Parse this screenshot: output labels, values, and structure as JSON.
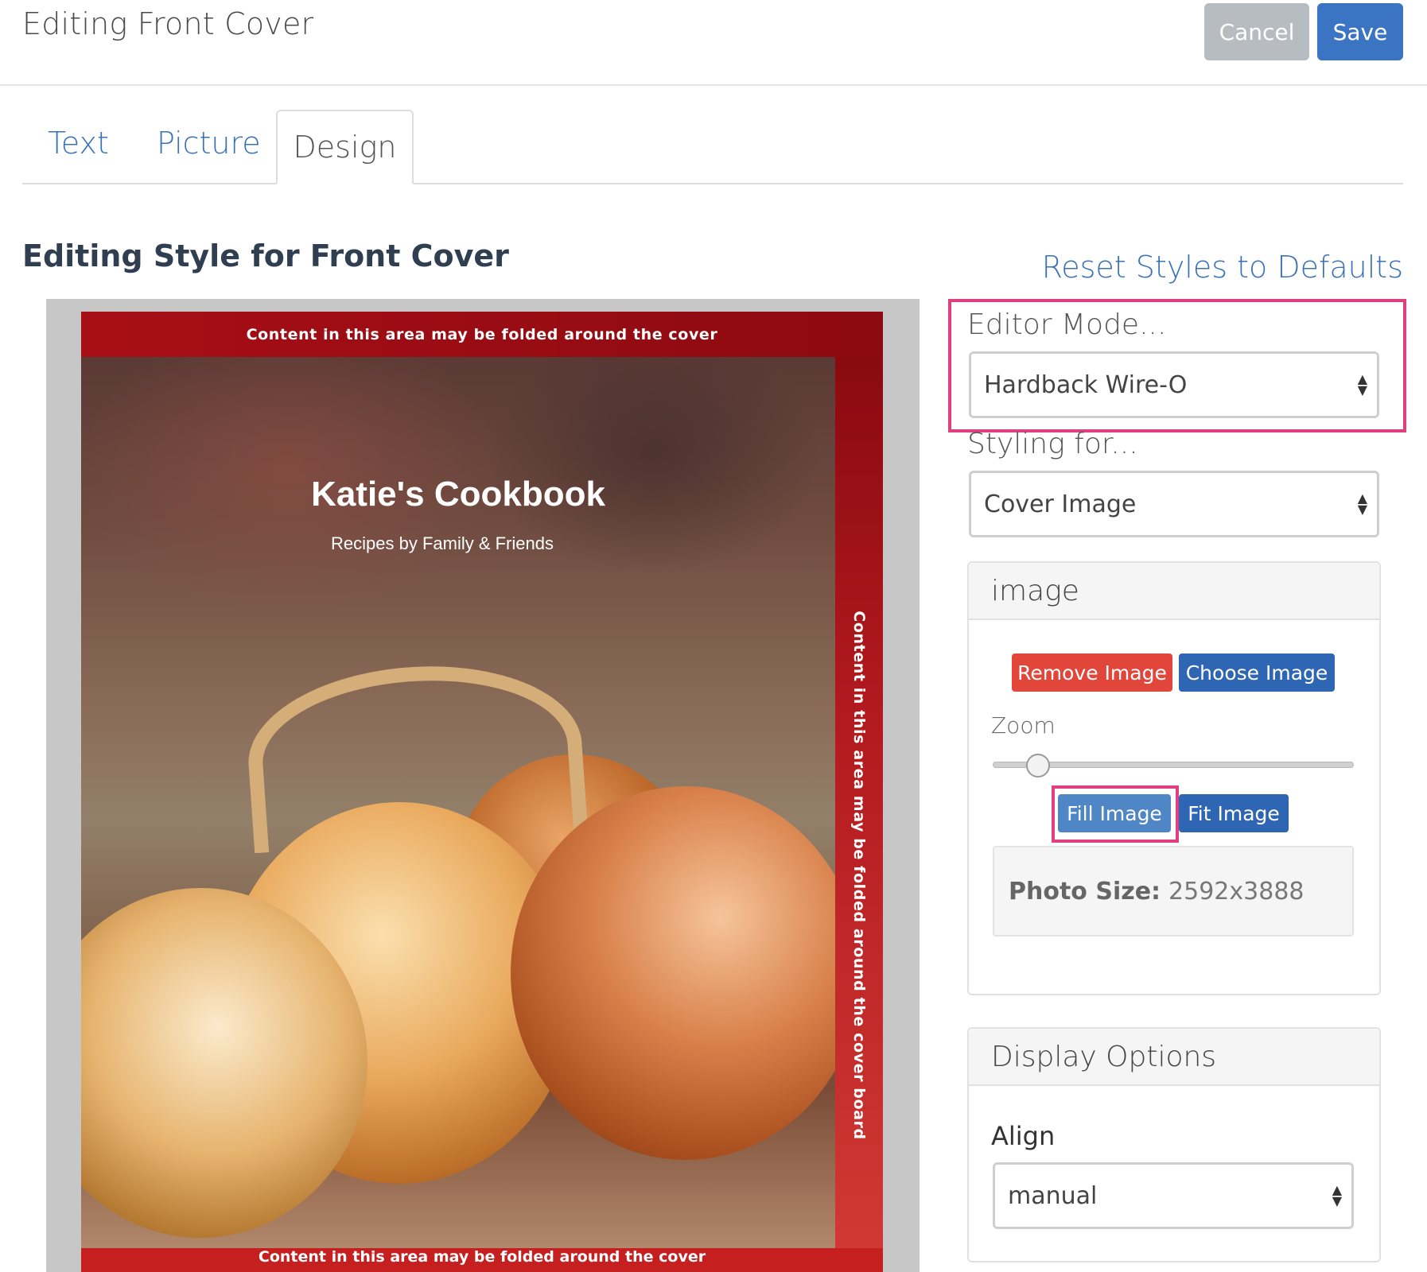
{
  "header": {
    "title": "Editing Front Cover",
    "cancel_label": "Cancel",
    "save_label": "Save"
  },
  "tabs": [
    {
      "label": "Text",
      "active": false
    },
    {
      "label": "Picture",
      "active": false
    },
    {
      "label": "Design",
      "active": true
    }
  ],
  "section": {
    "title": "Editing Style for Front Cover",
    "reset_label": "Reset Styles to Defaults"
  },
  "cover": {
    "fold_top_text": "Content in this area may be folded around the cover",
    "fold_right_text": "Content in this area may be folded around the cover board",
    "fold_bottom_text": "Content in this area may be folded around the cover",
    "title": "Katie's Cookbook",
    "subtitle": "Recipes by Family & Friends"
  },
  "editor_mode": {
    "label": "Editor Mode...",
    "value": "Hardback Wire-O"
  },
  "styling_for": {
    "label": "Styling for...",
    "value": "Cover Image"
  },
  "image_panel": {
    "heading": "image",
    "remove_label": "Remove Image",
    "choose_label": "Choose Image",
    "zoom_label": "Zoom",
    "zoom_fraction": 0.1,
    "fill_label": "Fill Image",
    "fit_label": "Fit Image",
    "photo_size_label": "Photo Size:",
    "photo_size_value": "2592x3888"
  },
  "display_panel": {
    "heading": "Display Options",
    "align_label": "Align",
    "align_value": "manual"
  },
  "colors": {
    "primary": "#3b74c2",
    "danger": "#e2463b",
    "highlight": "#e0407e",
    "cover_red": "#b01218"
  }
}
